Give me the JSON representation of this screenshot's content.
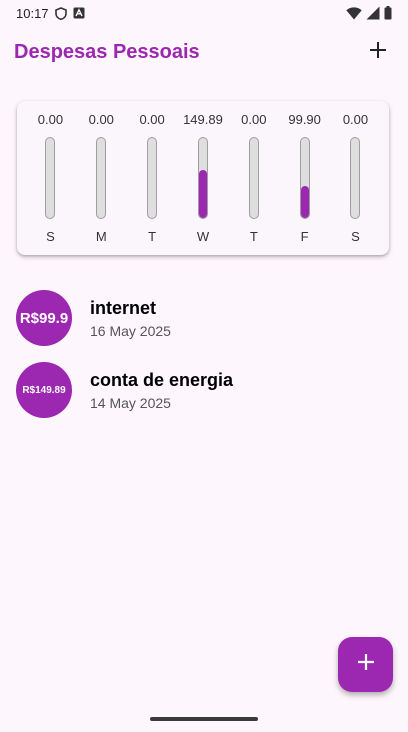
{
  "status_bar": {
    "time": "10:17",
    "icons_left": [
      "shield-icon",
      "a-box-icon"
    ],
    "icons_right": [
      "wifi-icon",
      "signal-icon",
      "battery-icon"
    ]
  },
  "app_bar": {
    "title": "Despesas Pessoais",
    "action_icon": "plus-icon"
  },
  "chart": {
    "days": [
      {
        "label": "S",
        "value": "0.00",
        "fraction": 0.0
      },
      {
        "label": "M",
        "value": "0.00",
        "fraction": 0.0
      },
      {
        "label": "T",
        "value": "0.00",
        "fraction": 0.0
      },
      {
        "label": "W",
        "value": "149.89",
        "fraction": 0.6
      },
      {
        "label": "T",
        "value": "0.00",
        "fraction": 0.0
      },
      {
        "label": "F",
        "value": "99.90",
        "fraction": 0.4
      },
      {
        "label": "S",
        "value": "0.00",
        "fraction": 0.0
      }
    ]
  },
  "transactions": [
    {
      "amount": "R$99.9",
      "title": "internet",
      "date": "16 May 2025"
    },
    {
      "amount": "R$149.89",
      "title": "conta de energia",
      "date": "14 May 2025"
    }
  ],
  "fab": {
    "icon": "plus-icon"
  },
  "colors": {
    "primary": "#9c27b0",
    "background": "#fdf6fc",
    "bar_track": "#dedede"
  }
}
